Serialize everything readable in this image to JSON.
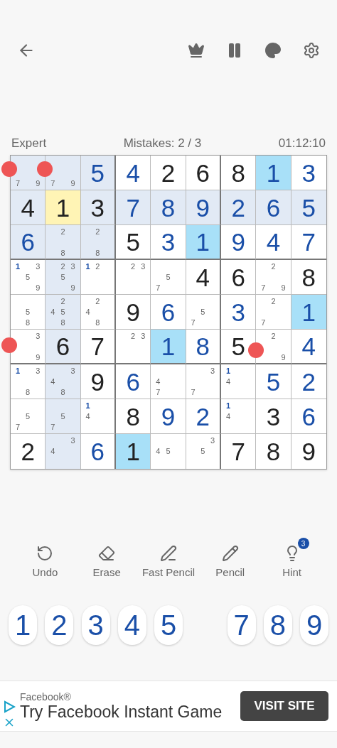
{
  "header": {
    "difficulty": "Expert",
    "mistakes": "Mistakes: 2 / 3",
    "timer": "01:12:10"
  },
  "grid": [
    [
      {
        "notes": [
          {
            "d": "7",
            "strong": false
          },
          {
            "d": "9",
            "strong": false
          }
        ],
        "peer": true,
        "selected": false,
        "match": false,
        "touch_left": true
      },
      {
        "notes": [
          {
            "d": "7",
            "strong": false
          },
          {
            "d": "9",
            "strong": false
          }
        ],
        "peer": true,
        "selected": false,
        "match": false,
        "touch_left": true
      },
      {
        "value": "5",
        "given": false,
        "peer": true,
        "selected": false,
        "match": false
      },
      {
        "value": "4",
        "given": false,
        "peer": false,
        "selected": false,
        "match": false
      },
      {
        "value": "2",
        "given": true,
        "peer": false,
        "selected": false,
        "match": false
      },
      {
        "value": "6",
        "given": true,
        "peer": false,
        "selected": false,
        "match": false
      },
      {
        "value": "8",
        "given": true,
        "peer": false,
        "selected": false,
        "match": false
      },
      {
        "value": "1",
        "given": false,
        "peer": false,
        "selected": false,
        "match": true
      },
      {
        "value": "3",
        "given": false,
        "peer": false,
        "selected": false,
        "match": false
      }
    ],
    [
      {
        "value": "4",
        "given": true,
        "peer": true,
        "selected": false,
        "match": false
      },
      {
        "value": "1",
        "given": true,
        "peer": false,
        "selected": true,
        "match": false
      },
      {
        "value": "3",
        "given": true,
        "peer": true,
        "selected": false,
        "match": false
      },
      {
        "value": "7",
        "given": false,
        "peer": true,
        "selected": false,
        "match": false
      },
      {
        "value": "8",
        "given": false,
        "peer": true,
        "selected": false,
        "match": false
      },
      {
        "value": "9",
        "given": false,
        "peer": true,
        "selected": false,
        "match": false
      },
      {
        "value": "2",
        "given": false,
        "peer": true,
        "selected": false,
        "match": false
      },
      {
        "value": "6",
        "given": false,
        "peer": true,
        "selected": false,
        "match": false
      },
      {
        "value": "5",
        "given": false,
        "peer": true,
        "selected": false,
        "match": false
      }
    ],
    [
      {
        "value": "6",
        "given": false,
        "peer": true,
        "selected": false,
        "match": false
      },
      {
        "notes": [
          {
            "d": "2",
            "strong": false
          },
          {
            "d": "8",
            "strong": false
          }
        ],
        "peer": true,
        "selected": false,
        "match": false
      },
      {
        "notes": [
          {
            "d": "2",
            "strong": false
          },
          {
            "d": "8",
            "strong": false
          }
        ],
        "peer": true,
        "selected": false,
        "match": false
      },
      {
        "value": "5",
        "given": true,
        "peer": false,
        "selected": false,
        "match": false
      },
      {
        "value": "3",
        "given": false,
        "peer": false,
        "selected": false,
        "match": false
      },
      {
        "value": "1",
        "given": false,
        "peer": false,
        "selected": false,
        "match": true
      },
      {
        "value": "9",
        "given": false,
        "peer": false,
        "selected": false,
        "match": false
      },
      {
        "value": "4",
        "given": false,
        "peer": false,
        "selected": false,
        "match": false
      },
      {
        "value": "7",
        "given": false,
        "peer": false,
        "selected": false,
        "match": false
      }
    ],
    [
      {
        "notes": [
          {
            "d": "1",
            "strong": true
          },
          {
            "d": "3",
            "strong": false
          },
          {
            "d": "5",
            "strong": false
          },
          {
            "d": "9",
            "strong": false
          }
        ],
        "peer": false,
        "selected": false,
        "match": false
      },
      {
        "notes": [
          {
            "d": "2",
            "strong": false
          },
          {
            "d": "3",
            "strong": false
          },
          {
            "d": "5",
            "strong": false
          },
          {
            "d": "9",
            "strong": false
          }
        ],
        "peer": true,
        "selected": false,
        "match": false
      },
      {
        "notes": [
          {
            "d": "1",
            "strong": true
          },
          {
            "d": "2",
            "strong": false
          }
        ],
        "peer": false,
        "selected": false,
        "match": false
      },
      {
        "notes": [
          {
            "d": "2",
            "strong": false
          },
          {
            "d": "3",
            "strong": false
          }
        ],
        "peer": false,
        "selected": false,
        "match": false
      },
      {
        "notes": [
          {
            "d": "5",
            "strong": false
          },
          {
            "d": "7",
            "strong": false
          }
        ],
        "peer": false,
        "selected": false,
        "match": false
      },
      {
        "value": "4",
        "given": true,
        "peer": false,
        "selected": false,
        "match": false
      },
      {
        "value": "6",
        "given": true,
        "peer": false,
        "selected": false,
        "match": false
      },
      {
        "notes": [
          {
            "d": "2",
            "strong": false
          },
          {
            "d": "7",
            "strong": false
          },
          {
            "d": "9",
            "strong": false
          }
        ],
        "peer": false,
        "selected": false,
        "match": false
      },
      {
        "value": "8",
        "given": true,
        "peer": false,
        "selected": false,
        "match": false
      }
    ],
    [
      {
        "notes": [
          {
            "d": "5",
            "strong": false
          },
          {
            "d": "8",
            "strong": false
          }
        ],
        "peer": false,
        "selected": false,
        "match": false
      },
      {
        "notes": [
          {
            "d": "2",
            "strong": false
          },
          {
            "d": "4",
            "strong": false
          },
          {
            "d": "5",
            "strong": false
          },
          {
            "d": "8",
            "strong": false
          }
        ],
        "peer": true,
        "selected": false,
        "match": false
      },
      {
        "notes": [
          {
            "d": "2",
            "strong": false
          },
          {
            "d": "4",
            "strong": false
          },
          {
            "d": "8",
            "strong": false
          }
        ],
        "peer": false,
        "selected": false,
        "match": false
      },
      {
        "value": "9",
        "given": true,
        "peer": false,
        "selected": false,
        "match": false
      },
      {
        "value": "6",
        "given": false,
        "peer": false,
        "selected": false,
        "match": false
      },
      {
        "notes": [
          {
            "d": "5",
            "strong": false
          },
          {
            "d": "7",
            "strong": false
          }
        ],
        "peer": false,
        "selected": false,
        "match": false
      },
      {
        "value": "3",
        "given": false,
        "peer": false,
        "selected": false,
        "match": false
      },
      {
        "notes": [
          {
            "d": "2",
            "strong": false
          },
          {
            "d": "7",
            "strong": false
          }
        ],
        "peer": false,
        "selected": false,
        "match": false
      },
      {
        "value": "1",
        "given": false,
        "peer": false,
        "selected": false,
        "match": true
      }
    ],
    [
      {
        "notes": [
          {
            "d": "3",
            "strong": false
          },
          {
            "d": "9",
            "strong": false
          }
        ],
        "peer": false,
        "selected": false,
        "match": false,
        "touch_left": true
      },
      {
        "value": "6",
        "given": true,
        "peer": true,
        "selected": false,
        "match": false
      },
      {
        "value": "7",
        "given": true,
        "peer": false,
        "selected": false,
        "match": false
      },
      {
        "notes": [
          {
            "d": "2",
            "strong": false
          },
          {
            "d": "3",
            "strong": false
          }
        ],
        "peer": false,
        "selected": false,
        "match": false
      },
      {
        "value": "1",
        "given": false,
        "peer": false,
        "selected": false,
        "match": true
      },
      {
        "value": "8",
        "given": false,
        "peer": false,
        "selected": false,
        "match": false
      },
      {
        "value": "5",
        "given": true,
        "peer": false,
        "selected": false,
        "match": false,
        "touch_right": true
      },
      {
        "notes": [
          {
            "d": "2",
            "strong": false
          },
          {
            "d": "9",
            "strong": false
          }
        ],
        "peer": false,
        "selected": false,
        "match": false
      },
      {
        "value": "4",
        "given": false,
        "peer": false,
        "selected": false,
        "match": false
      }
    ],
    [
      {
        "notes": [
          {
            "d": "1",
            "strong": true
          },
          {
            "d": "3",
            "strong": false
          },
          {
            "d": "8",
            "strong": false
          }
        ],
        "peer": false,
        "selected": false,
        "match": false
      },
      {
        "notes": [
          {
            "d": "3",
            "strong": false
          },
          {
            "d": "4",
            "strong": false
          },
          {
            "d": "8",
            "strong": false
          }
        ],
        "peer": true,
        "selected": false,
        "match": false
      },
      {
        "value": "9",
        "given": true,
        "peer": false,
        "selected": false,
        "match": false
      },
      {
        "value": "6",
        "given": false,
        "peer": false,
        "selected": false,
        "match": false
      },
      {
        "notes": [
          {
            "d": "4",
            "strong": false
          },
          {
            "d": "7",
            "strong": false
          }
        ],
        "peer": false,
        "selected": false,
        "match": false
      },
      {
        "notes": [
          {
            "d": "3",
            "strong": false
          },
          {
            "d": "7",
            "strong": false
          }
        ],
        "peer": false,
        "selected": false,
        "match": false
      },
      {
        "notes": [
          {
            "d": "1",
            "strong": true
          },
          {
            "d": "4",
            "strong": false
          }
        ],
        "peer": false,
        "selected": false,
        "match": false
      },
      {
        "value": "5",
        "given": false,
        "peer": false,
        "selected": false,
        "match": false
      },
      {
        "value": "2",
        "given": false,
        "peer": false,
        "selected": false,
        "match": false
      }
    ],
    [
      {
        "notes": [
          {
            "d": "5",
            "strong": false
          },
          {
            "d": "7",
            "strong": false
          }
        ],
        "peer": false,
        "selected": false,
        "match": false
      },
      {
        "notes": [
          {
            "d": "5",
            "strong": false
          },
          {
            "d": "7",
            "strong": false
          }
        ],
        "peer": true,
        "selected": false,
        "match": false
      },
      {
        "notes": [
          {
            "d": "1",
            "strong": true
          },
          {
            "d": "4",
            "strong": false
          }
        ],
        "peer": false,
        "selected": false,
        "match": false
      },
      {
        "value": "8",
        "given": true,
        "peer": false,
        "selected": false,
        "match": false
      },
      {
        "value": "9",
        "given": false,
        "peer": false,
        "selected": false,
        "match": false
      },
      {
        "value": "2",
        "given": false,
        "peer": false,
        "selected": false,
        "match": false
      },
      {
        "notes": [
          {
            "d": "1",
            "strong": true
          },
          {
            "d": "4",
            "strong": false
          }
        ],
        "peer": false,
        "selected": false,
        "match": false
      },
      {
        "value": "3",
        "given": true,
        "peer": false,
        "selected": false,
        "match": false
      },
      {
        "value": "6",
        "given": false,
        "peer": false,
        "selected": false,
        "match": false
      }
    ],
    [
      {
        "value": "2",
        "given": true,
        "peer": false,
        "selected": false,
        "match": false
      },
      {
        "notes": [
          {
            "d": "3",
            "strong": false
          },
          {
            "d": "4",
            "strong": false
          }
        ],
        "peer": true,
        "selected": false,
        "match": false
      },
      {
        "value": "6",
        "given": false,
        "peer": false,
        "selected": false,
        "match": false
      },
      {
        "value": "1",
        "given": true,
        "peer": false,
        "selected": false,
        "match": true
      },
      {
        "notes": [
          {
            "d": "4",
            "strong": false
          },
          {
            "d": "5",
            "strong": false
          }
        ],
        "peer": false,
        "selected": false,
        "match": false
      },
      {
        "notes": [
          {
            "d": "3",
            "strong": false
          },
          {
            "d": "5",
            "strong": false
          }
        ],
        "peer": false,
        "selected": false,
        "match": false
      },
      {
        "value": "7",
        "given": true,
        "peer": false,
        "selected": false,
        "match": false
      },
      {
        "value": "8",
        "given": true,
        "peer": false,
        "selected": false,
        "match": false
      },
      {
        "value": "9",
        "given": true,
        "peer": false,
        "selected": false,
        "match": false
      }
    ]
  ],
  "tools": [
    {
      "kind": "undo",
      "label": "Undo"
    },
    {
      "kind": "erase",
      "label": "Erase"
    },
    {
      "kind": "fast_pencil",
      "label": "Fast Pencil"
    },
    {
      "kind": "pencil",
      "label": "Pencil"
    },
    {
      "kind": "hint",
      "label": "Hint",
      "badge": "3"
    }
  ],
  "number_pad": [
    {
      "kind": "digit",
      "label": "1"
    },
    {
      "kind": "digit",
      "label": "2"
    },
    {
      "kind": "digit",
      "label": "3"
    },
    {
      "kind": "digit",
      "label": "4"
    },
    {
      "kind": "digit",
      "label": "5"
    },
    {
      "kind": "gap"
    },
    {
      "kind": "digit",
      "label": "7"
    },
    {
      "kind": "digit",
      "label": "8"
    },
    {
      "kind": "digit",
      "label": "9"
    }
  ],
  "ad": {
    "advertiser": "Facebook®",
    "headline": "Try Facebook Instant Game",
    "button": "VISIT SITE"
  }
}
